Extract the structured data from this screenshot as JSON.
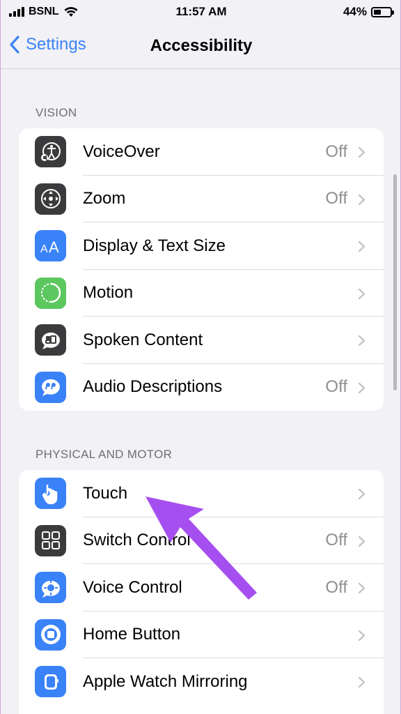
{
  "status_bar": {
    "carrier": "BSNL",
    "time": "11:57 AM",
    "battery": "44%",
    "battery_level": 0.44
  },
  "nav": {
    "back_label": "Settings",
    "title": "Accessibility"
  },
  "sections": [
    {
      "header": "VISION",
      "items": [
        {
          "label": "VoiceOver",
          "value": "Off",
          "icon": "voiceover-icon",
          "color": "#3b3b3d"
        },
        {
          "label": "Zoom",
          "value": "Off",
          "icon": "zoom-icon",
          "color": "#3b3b3d"
        },
        {
          "label": "Display & Text Size",
          "value": "",
          "icon": "text-size-icon",
          "color": "#3a82f7"
        },
        {
          "label": "Motion",
          "value": "",
          "icon": "motion-icon",
          "color": "#5cc75e"
        },
        {
          "label": "Spoken Content",
          "value": "",
          "icon": "speech-bubble-icon",
          "color": "#3b3b3d"
        },
        {
          "label": "Audio Descriptions",
          "value": "Off",
          "icon": "audio-description-icon",
          "color": "#3a82f7"
        }
      ]
    },
    {
      "header": "PHYSICAL AND MOTOR",
      "items": [
        {
          "label": "Touch",
          "value": "",
          "icon": "hand-touch-icon",
          "color": "#3a82f7"
        },
        {
          "label": "Switch Control",
          "value": "Off",
          "icon": "switch-grid-icon",
          "color": "#3b3b3d"
        },
        {
          "label": "Voice Control",
          "value": "Off",
          "icon": "voice-control-icon",
          "color": "#3a82f7"
        },
        {
          "label": "Home Button",
          "value": "",
          "icon": "home-button-icon",
          "color": "#3a82f7"
        },
        {
          "label": "Apple Watch Mirroring",
          "value": "",
          "icon": "watch-icon",
          "color": "#3a82f7"
        }
      ]
    }
  ],
  "colors": {
    "accent": "#3a82f7",
    "arrow": "#a64ff0"
  }
}
